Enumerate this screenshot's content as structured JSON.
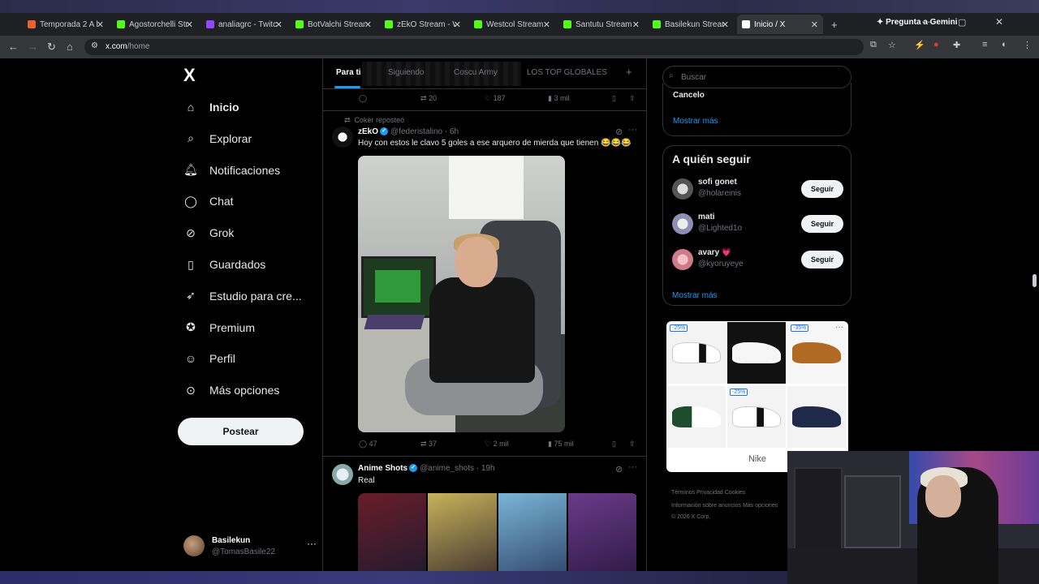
{
  "browser": {
    "tabs": [
      {
        "label": "Temporada 2 A la",
        "color": "#e8622d"
      },
      {
        "label": "Agostorchelli Stre",
        "color": "#53fc18"
      },
      {
        "label": "analiagrc - Twitch",
        "color": "#9146ff"
      },
      {
        "label": "BotValchi Stream",
        "color": "#53fc18"
      },
      {
        "label": "zEkO Stream - Wa",
        "color": "#53fc18"
      },
      {
        "label": "Westcol Stream",
        "color": "#53fc18"
      },
      {
        "label": "Santutu Stream -",
        "color": "#53fc18"
      },
      {
        "label": "Basilekun Stream",
        "color": "#53fc18"
      },
      {
        "label": "Inicio / X",
        "color": "#ffffff"
      }
    ],
    "gemini_label": "Pregunta a Gemini",
    "url_host": "x.com",
    "url_path": "/home"
  },
  "sidebar": {
    "logo": "X",
    "items": [
      {
        "label": "Inicio",
        "icon": "home-icon"
      },
      {
        "label": "Explorar",
        "icon": "search-icon"
      },
      {
        "label": "Notificaciones",
        "icon": "bell-icon"
      },
      {
        "label": "Chat",
        "icon": "chat-icon"
      },
      {
        "label": "Grok",
        "icon": "grok-icon"
      },
      {
        "label": "Guardados",
        "icon": "bookmark-icon"
      },
      {
        "label": "Estudio para cre...",
        "icon": "rocket-icon"
      },
      {
        "label": "Premium",
        "icon": "premium-icon"
      },
      {
        "label": "Perfil",
        "icon": "person-icon"
      },
      {
        "label": "Más opciones",
        "icon": "more-icon"
      }
    ],
    "post_label": "Postear",
    "profile_name": "Basilekun",
    "profile_handle": "@TomasBasile22",
    "profile_dots": "···"
  },
  "feed": {
    "tabs": [
      "Para ti",
      "Siguiendo",
      "Coscu Army",
      "LOS TOP GLOBALES"
    ],
    "add_tab": "+",
    "top_actions": {
      "replies": "",
      "retweets": "20",
      "likes": "187",
      "views": "3 mil"
    },
    "tweet1": {
      "repost_label": "Coker reposteó",
      "name": "zEkO",
      "handle": "@federistalino · 6h",
      "text": "Hoy con estos le clavo 5 goles a ese arquero de mierda que tienen 😂😂😂",
      "replies": "47",
      "retweets": "37",
      "likes": "2 mil",
      "views": "75 mil"
    },
    "tweet2": {
      "name": "Anime Shots",
      "handle": "@anime_shots · 19h",
      "text": "Real"
    }
  },
  "right": {
    "search_placeholder": "Buscar",
    "trend_last": "Cancelo",
    "show_more": "Mostrar más",
    "who_title": "A quién seguir",
    "who": [
      {
        "name": "sofi gonet",
        "handle": "@holareinis",
        "button": "Seguir"
      },
      {
        "name": "mati",
        "handle": "@Lighted1o",
        "button": "Seguir"
      },
      {
        "name": "avary 💗",
        "handle": "@kyoruyeye",
        "button": "Seguir"
      }
    ],
    "who_more": "Mostrar más",
    "ad_brand": "Nike",
    "ad_discounts": [
      "-25%",
      "-35%",
      "-25%"
    ],
    "footer_line1": "Términos    Privacidad    Cookies",
    "footer_line2": "Información sobre anuncios    Más opciones",
    "footer_line3": "© 2026 X Corp."
  }
}
